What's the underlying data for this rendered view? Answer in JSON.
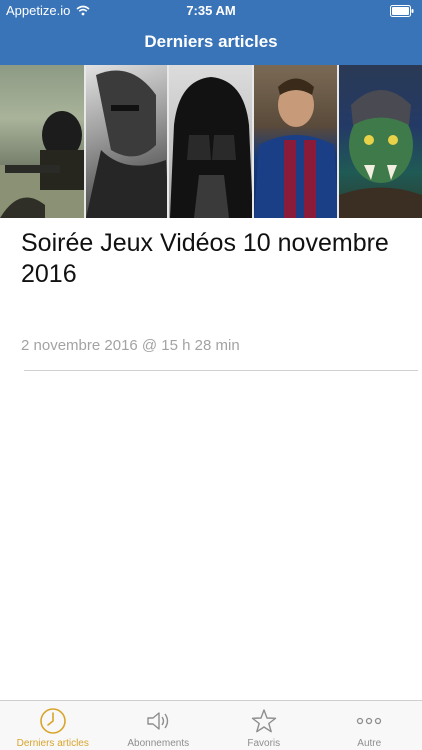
{
  "status_bar": {
    "carrier": "Appetize.io",
    "time": "7:35 AM"
  },
  "nav": {
    "title": "Derniers articles"
  },
  "article": {
    "title": "Soirée Jeux Vidéos 10 novembre 2016",
    "date": "2 novembre 2016 @ 15 h 28 min"
  },
  "tabbar": {
    "tabs": [
      {
        "label": "Derniers articles",
        "icon": "clock-icon",
        "active": true
      },
      {
        "label": "Abonnements",
        "icon": "speaker-icon",
        "active": false
      },
      {
        "label": "Favoris",
        "icon": "star-icon",
        "active": false
      },
      {
        "label": "Autre",
        "icon": "more-icon",
        "active": false
      }
    ]
  },
  "colors": {
    "header": "#3a74b8",
    "active_tab": "#d8a52c",
    "inactive_tab": "#8e8e8e",
    "date_text": "#a3a3a3"
  }
}
